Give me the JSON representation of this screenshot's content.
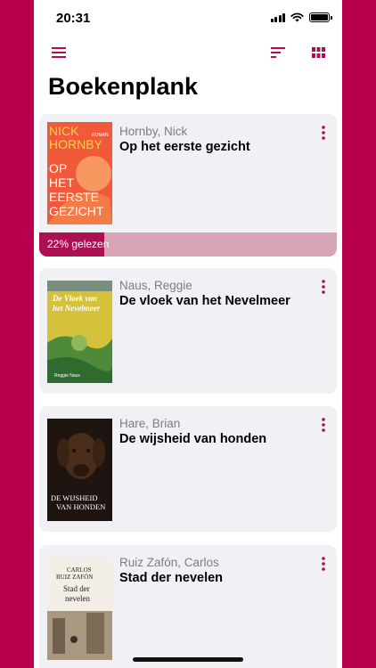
{
  "status_bar": {
    "time": "20:31"
  },
  "header": {
    "title": "Boekenplank"
  },
  "colors": {
    "accent": "#ad0f53",
    "progress_track": "#d8a4b8",
    "card_bg": "#f1f0f4"
  },
  "icons": {
    "menu": "hamburger-menu-icon",
    "sort": "sort-icon",
    "view": "grid-view-icon",
    "more": "more-vertical-icon"
  },
  "books": [
    {
      "author": "Hornby, Nick",
      "title": "Op het eerste gezicht",
      "progress_label": "22% gelezen",
      "progress": 0.22,
      "cover": {
        "lines": [
          "NICK",
          "HORNBY",
          "OP",
          "HET",
          "EERSTE",
          "GEZICHT"
        ],
        "tag": "ROMAN"
      }
    },
    {
      "author": "Naus, Reggie",
      "title": "De vloek van het Nevelmeer",
      "cover": {
        "lines": [
          "De Vloek van",
          "het Nevelmeer"
        ],
        "footer": "Reggie Naus"
      }
    },
    {
      "author": "Hare, Brian",
      "title": "De wijsheid van honden",
      "cover": {
        "lines": [
          "DE WIJSHEID",
          "VAN HONDEN"
        ]
      }
    },
    {
      "author": "Ruiz Zafón, Carlos",
      "title": "Stad der nevelen",
      "cover": {
        "lines": [
          "CARLOS",
          "RUIZ ZAFÓN",
          "Stad der",
          "nevelen"
        ]
      }
    }
  ]
}
